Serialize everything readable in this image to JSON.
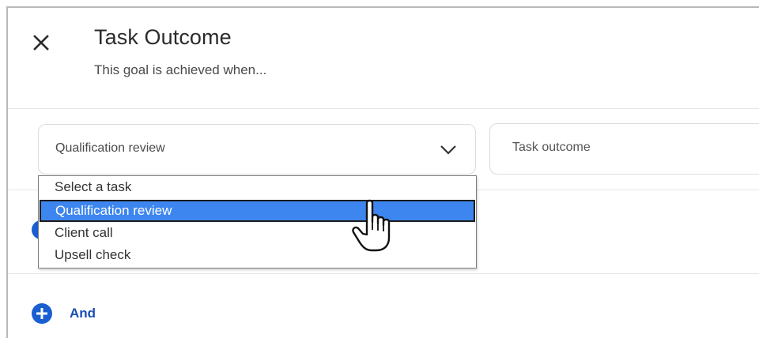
{
  "header": {
    "close_icon": "close-icon",
    "title": "Task Outcome",
    "subtitle": "This goal is achieved when..."
  },
  "task_select": {
    "selected_value": "Qualification review",
    "chevron_icon": "chevron-down-icon",
    "options": [
      {
        "label": "Select a task",
        "selected": false
      },
      {
        "label": "Qualification review",
        "selected": true
      },
      {
        "label": "Client call",
        "selected": false
      },
      {
        "label": "Upsell check",
        "selected": false
      }
    ]
  },
  "outcome_field": {
    "placeholder": "Task outcome"
  },
  "and_button": {
    "label": "And",
    "icon": "plus-circle-icon"
  },
  "colors": {
    "accent": "#1a5fd1",
    "highlight": "#3d86ef",
    "and_label": "#1a4fb5"
  }
}
